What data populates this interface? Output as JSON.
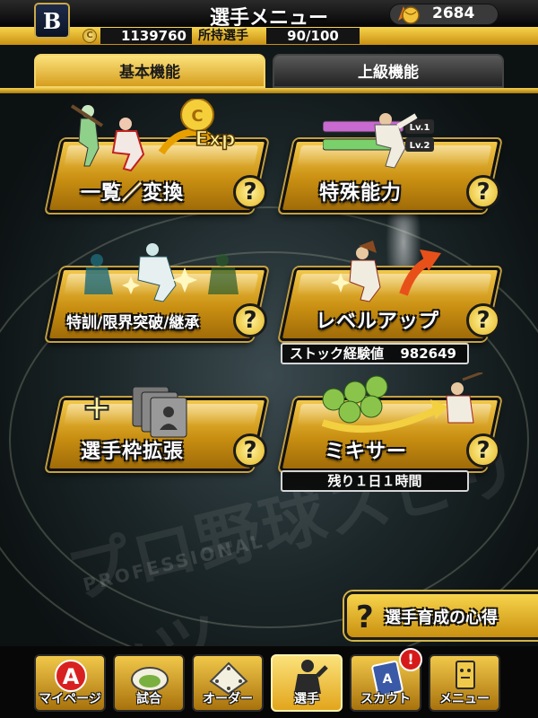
{
  "header": {
    "title": "選手メニュー",
    "team_logo_letter": "B",
    "gold": "2684",
    "coins": "1139760",
    "roster_label": "所持選手",
    "roster_count": "90/100",
    "coin_symbol": "C"
  },
  "tabs": [
    {
      "label": "基本機能",
      "active": true
    },
    {
      "label": "上級機能",
      "active": false
    }
  ],
  "features": [
    {
      "label": "一覧／変換",
      "art_text": "Exp",
      "help": "?"
    },
    {
      "label": "特殊能力",
      "art_badges": [
        "Lv.1",
        "Lv.2"
      ],
      "help": "?"
    },
    {
      "label": "特訓/限界突破/継承",
      "help": "?"
    },
    {
      "label": "レベルアップ",
      "help": "?"
    },
    {
      "label": "選手枠拡張",
      "art_text": "+",
      "help": "?"
    },
    {
      "label": "ミキサー",
      "help": "?"
    }
  ],
  "stock": {
    "label": "ストック経験値",
    "value": "982649"
  },
  "mixer_status": "残り１日１時間",
  "guide": {
    "icon": "?",
    "label": "選手育成の心得"
  },
  "nav": [
    {
      "label": "マイページ",
      "icon": "a-logo-icon",
      "active": false
    },
    {
      "label": "試合",
      "icon": "stadium-icon",
      "active": false
    },
    {
      "label": "オーダー",
      "icon": "field-diagram-icon",
      "active": false
    },
    {
      "label": "選手",
      "icon": "player-icon",
      "active": true
    },
    {
      "label": "スカウト",
      "icon": "scout-card-icon",
      "active": false,
      "badge": "!"
    },
    {
      "label": "メニュー",
      "icon": "menu-character-icon",
      "active": false
    }
  ],
  "colors": {
    "gold_light": "#f7d54c",
    "gold_dark": "#c98f12",
    "badge_red": "#d61a1a"
  }
}
